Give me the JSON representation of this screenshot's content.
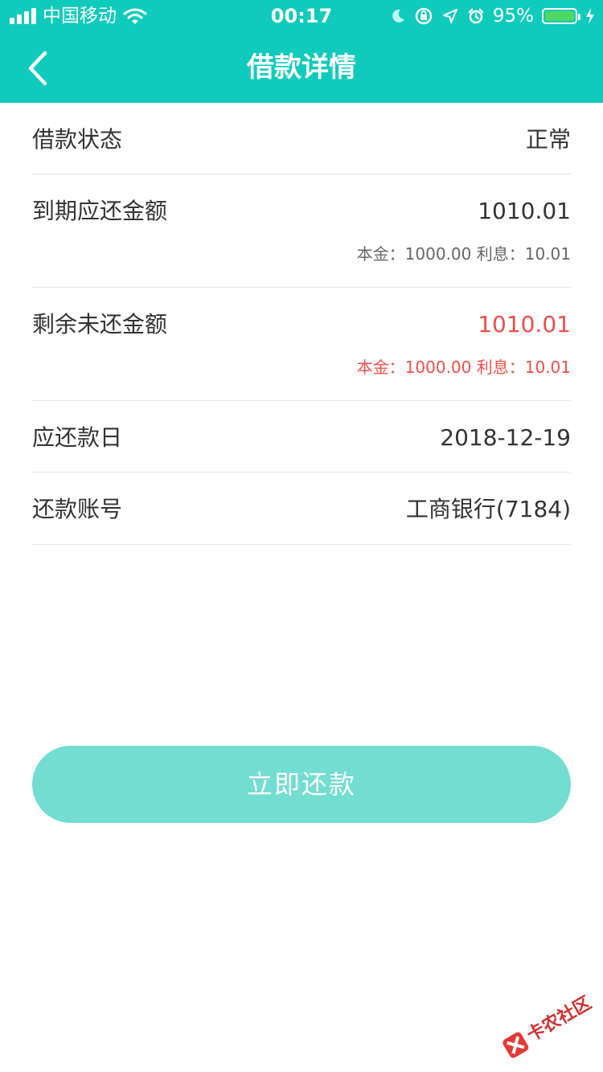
{
  "status_bar": {
    "carrier": "中国移动",
    "time": "00:17",
    "battery_percent": "95%",
    "icons": [
      "signal-icon",
      "wifi-icon",
      "moon-icon",
      "lock-rotation-icon",
      "location-arrow-icon",
      "alarm-icon",
      "battery-icon",
      "charging-icon"
    ]
  },
  "header": {
    "title": "借款详情",
    "back_icon": "chevron-left-icon",
    "background": "#10cbbc"
  },
  "details": {
    "loan_status_label": "借款状态",
    "loan_status_value": "正常",
    "due_amount_label": "到期应还金额",
    "due_amount_value": "1010.01",
    "due_amount_breakdown": "本金：1000.00  利息：10.01",
    "remaining_label": "剩余未还金额",
    "remaining_value": "1010.01",
    "remaining_breakdown": "本金：1000.00  利息：10.01",
    "repay_date_label": "应还款日",
    "repay_date_value": "2018-12-19",
    "account_label": "还款账号",
    "account_value": "工商银行(7184)"
  },
  "actions": {
    "pay_now": "立即还款",
    "pay_now_color": "#73ddd1"
  },
  "watermark": {
    "text": "卡农社区"
  },
  "colors": {
    "highlight_red": "#f04e4a",
    "divider": "#e6e6e6"
  }
}
